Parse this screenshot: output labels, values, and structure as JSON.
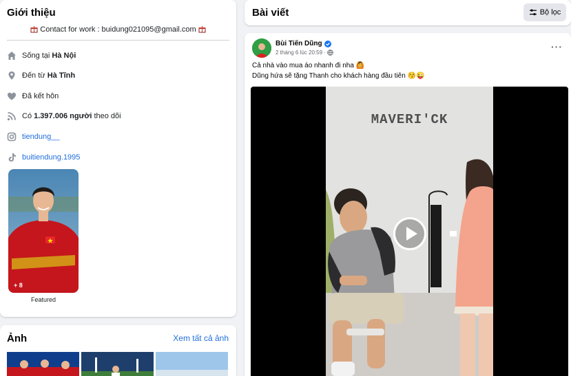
{
  "intro": {
    "title": "Giới thiệu",
    "contact": "Contact for work : buidung021095@gmail.com",
    "lives_prefix": "Sống tại ",
    "lives_place": "Hà Nội",
    "from_prefix": "Đến từ ",
    "from_place": "Hà Tĩnh",
    "relationship": "Đã kết hôn",
    "followers_prefix": "Có ",
    "followers_count": "1.397.006 người",
    "followers_suffix": " theo dõi",
    "instagram": "tiendung__",
    "tiktok": "buitiendung.1995",
    "featured_count": "+ 8",
    "featured_label": "Featured"
  },
  "photos": {
    "title": "Ảnh",
    "see_all": "Xem tất cả ảnh"
  },
  "posts": {
    "title": "Bài viết",
    "filter_label": "Bộ lọc"
  },
  "post": {
    "author": "Bùi Tiến Dũng",
    "time": "2 tháng 6 lúc 20:59 ·",
    "line1": "Cả nhà vào mua áo nhanh đi nha 🙆",
    "line2": "Dũng hứa sẽ tặng Thanh cho khách hàng đầu tiên 😚😜",
    "video_brand": "MAVERI'CK",
    "more": "···"
  },
  "colors": {
    "link": "#216fdb",
    "background": "#f0f2f5",
    "verified": "#1877f2"
  }
}
